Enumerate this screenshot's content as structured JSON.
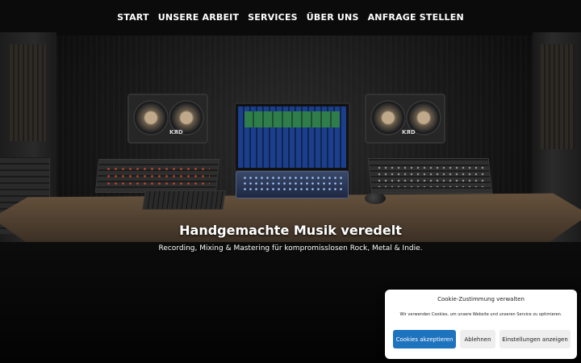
{
  "nav": {
    "items": [
      {
        "label": "START"
      },
      {
        "label": "UNSERE ARBEIT"
      },
      {
        "label": "SERVICES"
      },
      {
        "label": "ÜBER UNS"
      },
      {
        "label": "ANFRAGE STELLEN"
      }
    ]
  },
  "hero": {
    "title": "Handgemachte Musik veredelt",
    "subtitle": "Recording, Mixing & Mastering für kompromisslosen Rock, Metal & Indie.",
    "speaker_badge": "KЯD"
  },
  "cookie": {
    "title": "Cookie-Zustimmung verwalten",
    "text": "Wir verwenden Cookies, um unsere Website und unseren Service zu optimieren.",
    "accept_label": "Cookies akzeptieren",
    "deny_label": "Ablehnen",
    "settings_label": "Einstellungen anzeigen"
  },
  "colors": {
    "accept_button": "#1e73be",
    "secondary_button": "#eeeeee",
    "nav_text": "#ffffff"
  }
}
